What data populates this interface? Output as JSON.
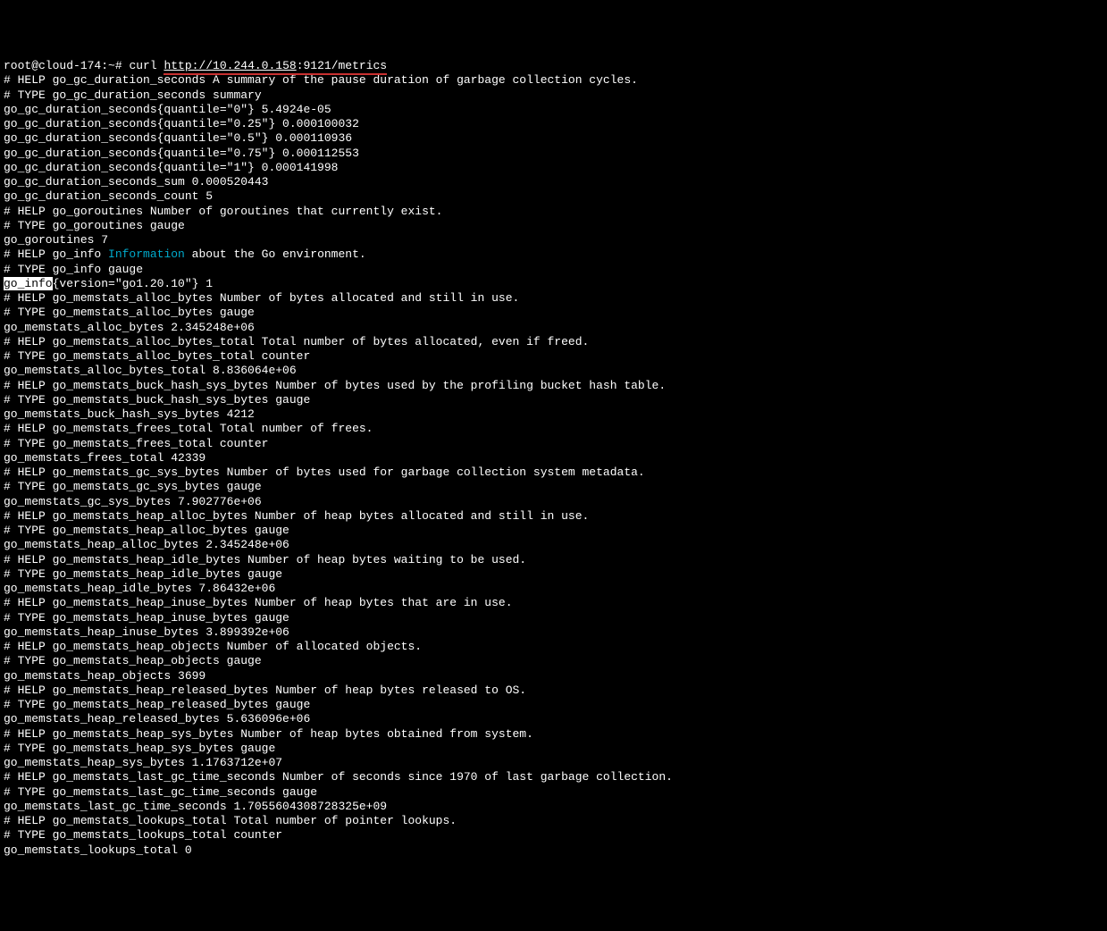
{
  "prompt": {
    "user_host": "root@cloud-174:~# ",
    "cmd": "curl ",
    "url_scheme_host": "http://10.244.0.158",
    "url_port_path": ":9121/metrics"
  },
  "info_literal": "Information",
  "go_info_label": "go_info",
  "lines": [
    "# HELP go_gc_duration_seconds A summary of the pause duration of garbage collection cycles.",
    "# TYPE go_gc_duration_seconds summary",
    "go_gc_duration_seconds{quantile=\"0\"} 5.4924e-05",
    "go_gc_duration_seconds{quantile=\"0.25\"} 0.000100032",
    "go_gc_duration_seconds{quantile=\"0.5\"} 0.000110936",
    "go_gc_duration_seconds{quantile=\"0.75\"} 0.000112553",
    "go_gc_duration_seconds{quantile=\"1\"} 0.000141998",
    "go_gc_duration_seconds_sum 0.000520443",
    "go_gc_duration_seconds_count 5",
    "# HELP go_goroutines Number of goroutines that currently exist.",
    "# TYPE go_goroutines gauge",
    "go_goroutines 7",
    "# HELP go_info ",
    " about the Go environment.",
    "# TYPE go_info gauge",
    "{version=\"go1.20.10\"} 1",
    "# HELP go_memstats_alloc_bytes Number of bytes allocated and still in use.",
    "# TYPE go_memstats_alloc_bytes gauge",
    "go_memstats_alloc_bytes 2.345248e+06",
    "# HELP go_memstats_alloc_bytes_total Total number of bytes allocated, even if freed.",
    "# TYPE go_memstats_alloc_bytes_total counter",
    "go_memstats_alloc_bytes_total 8.836064e+06",
    "# HELP go_memstats_buck_hash_sys_bytes Number of bytes used by the profiling bucket hash table.",
    "# TYPE go_memstats_buck_hash_sys_bytes gauge",
    "go_memstats_buck_hash_sys_bytes 4212",
    "# HELP go_memstats_frees_total Total number of frees.",
    "# TYPE go_memstats_frees_total counter",
    "go_memstats_frees_total 42339",
    "# HELP go_memstats_gc_sys_bytes Number of bytes used for garbage collection system metadata.",
    "# TYPE go_memstats_gc_sys_bytes gauge",
    "go_memstats_gc_sys_bytes 7.902776e+06",
    "# HELP go_memstats_heap_alloc_bytes Number of heap bytes allocated and still in use.",
    "# TYPE go_memstats_heap_alloc_bytes gauge",
    "go_memstats_heap_alloc_bytes 2.345248e+06",
    "# HELP go_memstats_heap_idle_bytes Number of heap bytes waiting to be used.",
    "# TYPE go_memstats_heap_idle_bytes gauge",
    "go_memstats_heap_idle_bytes 7.86432e+06",
    "# HELP go_memstats_heap_inuse_bytes Number of heap bytes that are in use.",
    "# TYPE go_memstats_heap_inuse_bytes gauge",
    "go_memstats_heap_inuse_bytes 3.899392e+06",
    "# HELP go_memstats_heap_objects Number of allocated objects.",
    "# TYPE go_memstats_heap_objects gauge",
    "go_memstats_heap_objects 3699",
    "# HELP go_memstats_heap_released_bytes Number of heap bytes released to OS.",
    "# TYPE go_memstats_heap_released_bytes gauge",
    "go_memstats_heap_released_bytes 5.636096e+06",
    "# HELP go_memstats_heap_sys_bytes Number of heap bytes obtained from system.",
    "# TYPE go_memstats_heap_sys_bytes gauge",
    "go_memstats_heap_sys_bytes 1.1763712e+07",
    "# HELP go_memstats_last_gc_time_seconds Number of seconds since 1970 of last garbage collection.",
    "# TYPE go_memstats_last_gc_time_seconds gauge",
    "go_memstats_last_gc_time_seconds 1.7055604308728325e+09",
    "# HELP go_memstats_lookups_total Total number of pointer lookups.",
    "# TYPE go_memstats_lookups_total counter",
    "go_memstats_lookups_total 0"
  ]
}
